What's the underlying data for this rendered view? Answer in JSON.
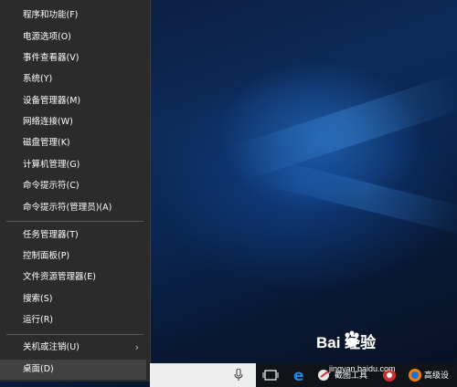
{
  "menu": {
    "items": [
      {
        "label": "程序和功能(F)"
      },
      {
        "label": "电源选项(O)"
      },
      {
        "label": "事件查看器(V)"
      },
      {
        "label": "系统(Y)"
      },
      {
        "label": "设备管理器(M)"
      },
      {
        "label": "网络连接(W)"
      },
      {
        "label": "磁盘管理(K)"
      },
      {
        "label": "计算机管理(G)"
      },
      {
        "label": "命令提示符(C)"
      },
      {
        "label": "命令提示符(管理员)(A)"
      },
      {
        "label": "任务管理器(T)"
      },
      {
        "label": "控制面板(P)"
      },
      {
        "label": "文件资源管理器(E)"
      },
      {
        "label": "搜索(S)"
      },
      {
        "label": "运行(R)"
      },
      {
        "label": "关机或注销(U)"
      },
      {
        "label": "桌面(D)"
      }
    ],
    "highlighted": "桌面(D)"
  },
  "taskbar": {
    "app_label_1": "截图工具",
    "app_label_2": "高级设"
  },
  "watermark": {
    "brand": "Bai  经验",
    "url": "jingyan.baidu.com"
  },
  "colors": {
    "menu_bg": "#2b2b2b",
    "highlight": "#414141",
    "accent_blue": "#1e6fd9"
  }
}
